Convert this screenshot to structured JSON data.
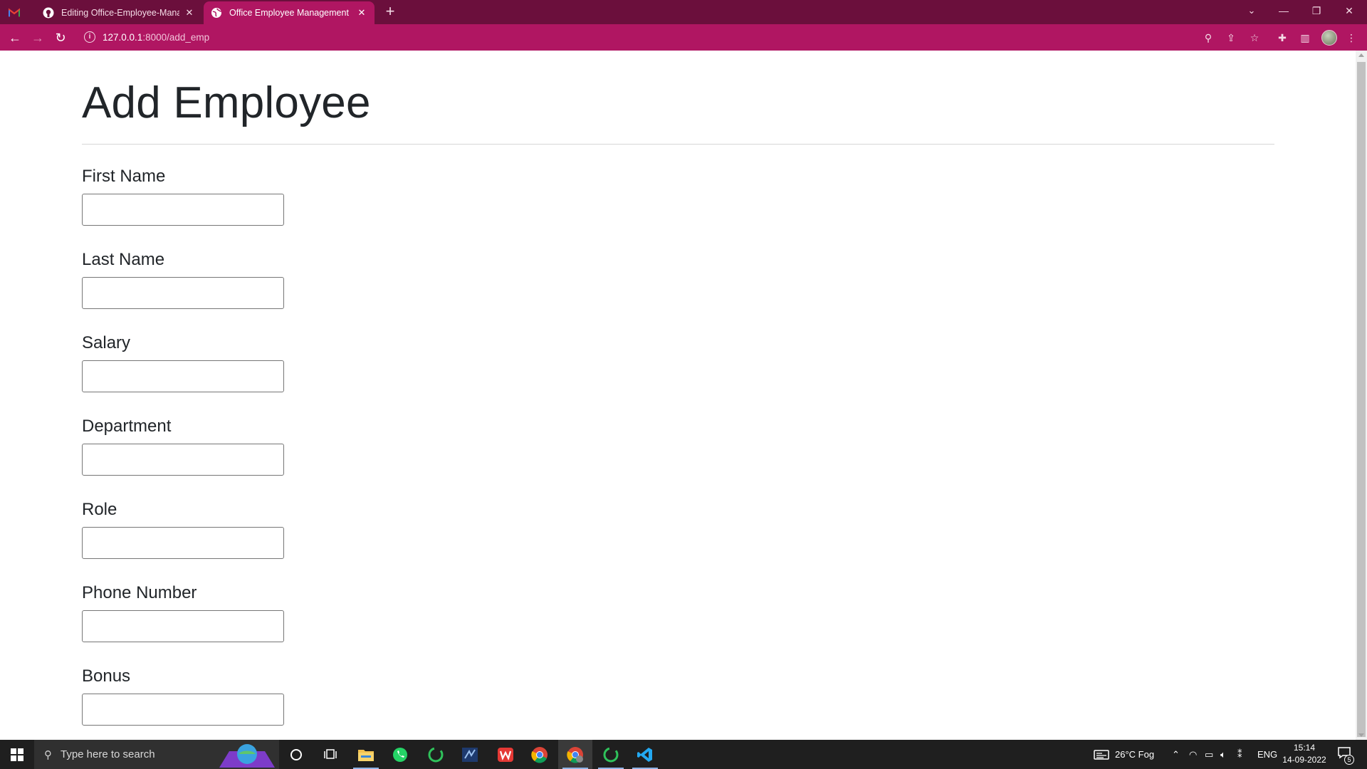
{
  "browser": {
    "tabs": [
      {
        "title": "",
        "icon": "gmail-icon"
      },
      {
        "title": "Editing Office-Employee-Manage",
        "icon": "github-icon"
      },
      {
        "title": "Office Employee Management Sy",
        "icon": "globe-icon",
        "active": true
      }
    ],
    "url": {
      "host": "127.0.0.1",
      "path": ":8000/add_emp"
    },
    "accent_color": "#b01662",
    "tabbar_color": "#6b0f3c"
  },
  "page": {
    "title": "Add Employee",
    "fields": [
      {
        "label": "First Name",
        "value": ""
      },
      {
        "label": "Last Name",
        "value": ""
      },
      {
        "label": "Salary",
        "value": ""
      },
      {
        "label": "Department",
        "value": ""
      },
      {
        "label": "Role",
        "value": ""
      },
      {
        "label": "Phone Number",
        "value": ""
      },
      {
        "label": "Bonus",
        "value": ""
      }
    ]
  },
  "taskbar": {
    "search_placeholder": "Type here to search",
    "weather": "26°C  Fog",
    "language": "ENG",
    "time": "15:14",
    "date": "14-09-2022",
    "notification_count": "5"
  }
}
